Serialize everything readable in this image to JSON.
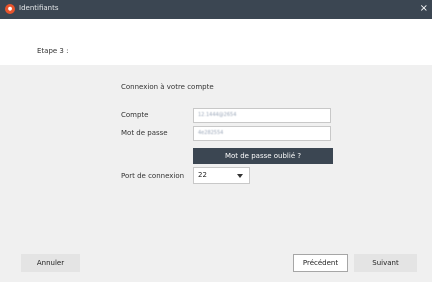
{
  "window": {
    "title": "Identifiants",
    "close_glyph": "×",
    "app_icon": "app-logo-icon"
  },
  "step": {
    "label": "Etape 3 :"
  },
  "form": {
    "section_title": "Connexion à votre compte",
    "account_label": "Compte",
    "account_value": "12.1444@2654",
    "password_label": "Mot de passe",
    "password_value": "4e282554",
    "forgot_password_label": "Mot de passe oublié ?",
    "port_label": "Port de connexion",
    "port_value": "22"
  },
  "footer": {
    "cancel_label": "Annuler",
    "previous_label": "Précédent",
    "next_label": "Suivant"
  },
  "colors": {
    "titlebar": "#3b4652",
    "accent_icon": "#e8542c",
    "panel_background": "#f0f0f0"
  }
}
